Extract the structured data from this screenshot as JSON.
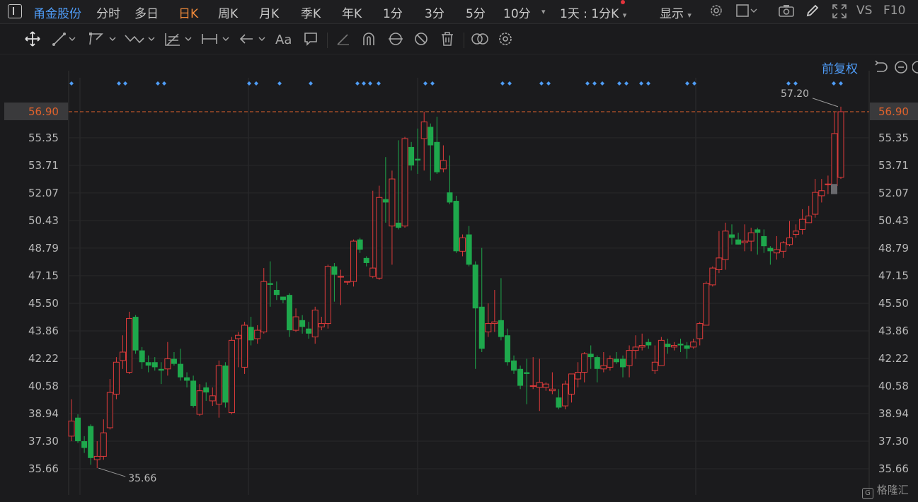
{
  "header": {
    "stock_name": "甬金股份",
    "tabs": [
      {
        "label": "分时"
      },
      {
        "label": "多日"
      },
      {
        "label": "日K"
      },
      {
        "label": "周K"
      },
      {
        "label": "月K"
      },
      {
        "label": "季K"
      },
      {
        "label": "年K"
      },
      {
        "label": "1分"
      },
      {
        "label": "3分"
      },
      {
        "label": "5分"
      },
      {
        "label": "10分"
      }
    ],
    "active_tab": "日K",
    "interval_select": "1天 : 1分K",
    "display_menu": "显示",
    "vs_label": "VS",
    "f10_label": "F10"
  },
  "chart_controls": {
    "adjust_label": "前复权"
  },
  "watermark": "格隆汇",
  "colors": {
    "up": "#e03b3b",
    "down": "#1ea84c",
    "accent": "#4f9cf7",
    "tab_active": "#f08a3a",
    "ref_line": "#e0622c"
  },
  "chart_data": {
    "type": "candlestick",
    "y_ticks": [
      "56.90",
      "55.35",
      "53.71",
      "52.07",
      "50.43",
      "48.79",
      "47.15",
      "45.50",
      "43.86",
      "42.22",
      "40.58",
      "38.94",
      "37.30",
      "35.66"
    ],
    "ylim": [
      34.0,
      58.7
    ],
    "current_price": "56.90",
    "max_label": "57.20",
    "min_label": "35.66",
    "candles": [
      [
        37.6,
        38.5,
        37.3,
        39.8
      ],
      [
        38.7,
        37.3,
        37.2,
        38.9
      ],
      [
        37.3,
        36.9,
        36.6,
        37.6
      ],
      [
        38.2,
        36.3,
        35.9,
        38.3
      ],
      [
        36.2,
        36.4,
        35.7,
        37.3
      ],
      [
        36.4,
        37.8,
        36.2,
        38.6
      ],
      [
        38.1,
        40.2,
        38.0,
        41.0
      ],
      [
        40.1,
        42.0,
        39.8,
        42.3
      ],
      [
        42.1,
        42.6,
        41.6,
        43.6
      ],
      [
        41.4,
        44.6,
        41.3,
        45.0
      ],
      [
        44.7,
        42.7,
        42.5,
        44.8
      ],
      [
        42.7,
        42.0,
        41.6,
        42.9
      ],
      [
        42.0,
        41.8,
        41.4,
        42.4
      ],
      [
        42.0,
        41.7,
        41.5,
        42.3
      ],
      [
        41.6,
        41.5,
        40.7,
        42.0
      ],
      [
        41.6,
        42.2,
        41.2,
        43.2
      ],
      [
        42.2,
        41.9,
        41.8,
        42.6
      ],
      [
        41.9,
        41.1,
        40.9,
        42.8
      ],
      [
        41.1,
        40.9,
        40.5,
        41.4
      ],
      [
        40.9,
        39.4,
        39.3,
        41.2
      ],
      [
        38.9,
        40.3,
        38.8,
        40.7
      ],
      [
        40.5,
        40.2,
        39.7,
        40.8
      ],
      [
        39.7,
        40.0,
        39.4,
        40.5
      ],
      [
        39.5,
        41.8,
        38.7,
        42.1
      ],
      [
        41.8,
        39.6,
        39.3,
        42.0
      ],
      [
        39.0,
        43.3,
        38.9,
        43.5
      ],
      [
        43.4,
        43.6,
        41.7,
        43.8
      ],
      [
        41.7,
        44.2,
        41.3,
        44.4
      ],
      [
        44.1,
        43.3,
        43.0,
        44.7
      ],
      [
        43.4,
        43.9,
        43.1,
        44.2
      ],
      [
        43.8,
        46.8,
        43.7,
        47.6
      ],
      [
        46.7,
        46.6,
        45.3,
        48.0
      ],
      [
        46.3,
        46.0,
        45.7,
        46.8
      ],
      [
        45.9,
        45.7,
        45.5,
        45.9
      ],
      [
        46.0,
        43.9,
        43.5,
        46.1
      ],
      [
        43.9,
        44.7,
        43.8,
        45.2
      ],
      [
        44.5,
        44.1,
        43.7,
        44.8
      ],
      [
        44.0,
        43.7,
        43.4,
        44.4
      ],
      [
        43.5,
        45.1,
        43.1,
        45.3
      ],
      [
        44.1,
        44.3,
        43.9,
        44.7
      ],
      [
        44.3,
        47.7,
        44.0,
        47.8
      ],
      [
        47.7,
        47.2,
        45.6,
        47.9
      ],
      [
        47.1,
        47.1,
        45.4,
        47.5
      ],
      [
        46.8,
        46.8,
        46.6,
        46.8
      ],
      [
        46.8,
        49.2,
        46.5,
        49.3
      ],
      [
        49.3,
        48.7,
        48.5,
        49.4
      ],
      [
        48.2,
        47.9,
        47.7,
        48.3
      ],
      [
        47.1,
        47.6,
        47.0,
        52.2
      ],
      [
        47.0,
        51.8,
        46.9,
        52.5
      ],
      [
        51.7,
        51.5,
        50.3,
        54.2
      ],
      [
        50.1,
        52.9,
        47.8,
        53.4
      ],
      [
        50.3,
        50.0,
        49.9,
        55.2
      ],
      [
        50.1,
        55.3,
        50.0,
        55.4
      ],
      [
        54.8,
        53.7,
        53.4,
        55.1
      ],
      [
        54.1,
        54.0,
        53.2,
        55.9
      ],
      [
        55.3,
        56.3,
        53.4,
        56.9
      ],
      [
        56.0,
        54.9,
        52.8,
        56.2
      ],
      [
        55.1,
        53.3,
        53.2,
        56.6
      ],
      [
        53.5,
        54.0,
        53.3,
        54.9
      ],
      [
        52.1,
        51.5,
        51.4,
        54.3
      ],
      [
        51.6,
        48.6,
        48.5,
        51.9
      ],
      [
        48.6,
        49.4,
        48.3,
        49.6
      ],
      [
        49.6,
        47.8,
        47.7,
        50.1
      ],
      [
        47.8,
        45.2,
        41.6,
        48.0
      ],
      [
        45.3,
        42.8,
        42.6,
        48.8
      ],
      [
        43.8,
        44.3,
        43.5,
        45.5
      ],
      [
        44.3,
        44.4,
        43.8,
        46.3
      ],
      [
        44.5,
        43.5,
        43.3,
        47.0
      ],
      [
        43.6,
        42.0,
        41.8,
        44.0
      ],
      [
        42.1,
        41.5,
        41.3,
        42.4
      ],
      [
        41.6,
        40.6,
        40.4,
        41.8
      ],
      [
        41.4,
        41.3,
        39.5,
        42.2
      ],
      [
        40.6,
        40.6,
        40.4,
        42.3
      ],
      [
        40.5,
        40.8,
        39.1,
        42.2
      ],
      [
        40.5,
        40.7,
        40.3,
        40.8
      ],
      [
        40.3,
        40.4,
        40.1,
        41.4
      ],
      [
        39.9,
        39.3,
        39.2,
        40.4
      ],
      [
        39.4,
        40.7,
        39.2,
        40.9
      ],
      [
        40.1,
        41.3,
        39.6,
        41.3
      ],
      [
        41.0,
        41.4,
        40.5,
        42.0
      ],
      [
        41.4,
        42.5,
        40.8,
        42.6
      ],
      [
        42.5,
        42.3,
        41.6,
        43.0
      ],
      [
        42.3,
        41.6,
        40.8,
        42.4
      ],
      [
        41.6,
        41.8,
        41.4,
        42.6
      ],
      [
        41.7,
        42.2,
        41.5,
        42.4
      ],
      [
        42.2,
        42.0,
        41.9,
        42.6
      ],
      [
        42.2,
        41.7,
        41.1,
        42.4
      ],
      [
        41.8,
        42.7,
        41.1,
        43.0
      ],
      [
        42.7,
        42.9,
        42.2,
        43.6
      ],
      [
        42.9,
        43.0,
        42.7,
        43.7
      ],
      [
        43.2,
        43.0,
        42.8,
        43.4
      ],
      [
        41.5,
        42.0,
        41.3,
        43.0
      ],
      [
        41.8,
        43.3,
        41.8,
        43.5
      ],
      [
        43.1,
        42.9,
        42.5,
        43.4
      ],
      [
        42.9,
        43.0,
        42.7,
        43.2
      ],
      [
        43.1,
        43.0,
        42.6,
        43.4
      ],
      [
        43.0,
        42.8,
        42.2,
        43.2
      ],
      [
        42.9,
        43.2,
        42.8,
        43.4
      ],
      [
        43.4,
        44.3,
        43.0,
        44.4
      ],
      [
        44.2,
        46.7,
        44.2,
        46.8
      ],
      [
        46.6,
        47.6,
        46.5,
        47.7
      ],
      [
        47.5,
        48.2,
        47.3,
        49.8
      ],
      [
        48.1,
        49.8,
        47.5,
        50.3
      ],
      [
        49.6,
        49.4,
        49.0,
        50.2
      ],
      [
        49.3,
        49.0,
        49.0,
        49.7
      ],
      [
        49.1,
        49.2,
        48.6,
        50.2
      ],
      [
        49.2,
        49.7,
        48.6,
        50.0
      ],
      [
        49.9,
        49.7,
        48.4,
        50.0
      ],
      [
        49.5,
        48.9,
        48.5,
        49.9
      ],
      [
        48.8,
        48.6,
        47.8,
        48.9
      ],
      [
        48.5,
        48.7,
        48.1,
        49.5
      ],
      [
        48.6,
        49.1,
        48.2,
        49.2
      ],
      [
        49.0,
        49.4,
        48.9,
        50.4
      ],
      [
        49.6,
        49.8,
        49.4,
        50.2
      ],
      [
        49.9,
        50.5,
        49.6,
        51.1
      ],
      [
        50.3,
        50.7,
        50.3,
        51.3
      ],
      [
        50.8,
        52.1,
        50.6,
        52.9
      ],
      [
        51.9,
        52.2,
        51.5,
        52.9
      ],
      [
        52.6,
        52.6,
        52.0,
        53.1
      ],
      [
        52.5,
        55.6,
        52.0,
        56.9
      ],
      [
        53.0,
        56.9,
        52.9,
        57.2
      ]
    ]
  }
}
